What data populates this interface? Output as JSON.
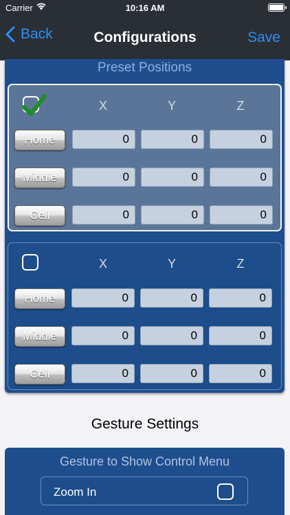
{
  "status": {
    "carrier": "Carrier",
    "time": "10:16 AM"
  },
  "nav": {
    "back_label": "Back",
    "title": "Configurations",
    "save_label": "Save"
  },
  "preset": {
    "title": "Preset Positions",
    "axes": [
      "X",
      "Y",
      "Z"
    ],
    "configs": [
      {
        "checked": true,
        "rows": [
          {
            "label": "Home",
            "x": "0",
            "y": "0",
            "z": "0"
          },
          {
            "label": "Middle",
            "x": "0",
            "y": "0",
            "z": "0"
          },
          {
            "label": "Cell",
            "x": "0",
            "y": "0",
            "z": "0"
          }
        ]
      },
      {
        "checked": false,
        "rows": [
          {
            "label": "Home",
            "x": "0",
            "y": "0",
            "z": "0"
          },
          {
            "label": "Middle",
            "x": "0",
            "y": "0",
            "z": "0"
          },
          {
            "label": "Cell",
            "x": "0",
            "y": "0",
            "z": "0"
          }
        ]
      }
    ]
  },
  "gesture": {
    "section_title": "Gesture Settings",
    "heading": "Gesture to Show Control Menu",
    "option_label": "Zoom In",
    "option_checked": false
  },
  "colors": {
    "accent": "#2f8ef8",
    "panel": "#1f4e8e",
    "checkmark": "#1e8c2a"
  }
}
